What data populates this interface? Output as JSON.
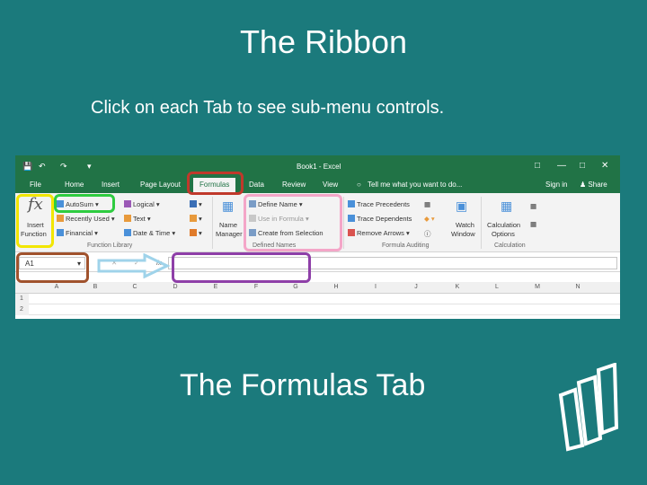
{
  "slide": {
    "title": "The Ribbon",
    "subtitle": "Click on each Tab to see sub-menu controls.",
    "caption": "The Formulas Tab"
  },
  "excel": {
    "window_title": "Book1 - Excel",
    "tabs": [
      "File",
      "Home",
      "Insert",
      "Page Layout",
      "Formulas",
      "Data",
      "Review",
      "View"
    ],
    "active_tab": "Formulas",
    "tell_me": "Tell me what you want to do...",
    "sign_in": "Sign in",
    "share": "Share",
    "function_library": {
      "insert_function": [
        "Insert",
        "Function"
      ],
      "autosum": "AutoSum",
      "recently_used": "Recently Used",
      "financial": "Financial",
      "logical": "Logical",
      "text": "Text",
      "date_time": "Date & Time",
      "group_label": "Function Library"
    },
    "defined_names": {
      "name_manager": [
        "Name",
        "Manager"
      ],
      "define_name": "Define Name",
      "use_in_formula": "Use in Formula",
      "create_from_selection": "Create from Selection",
      "group_label": "Defined Names"
    },
    "formula_auditing": {
      "trace_precedents": "Trace Precedents",
      "trace_dependents": "Trace Dependents",
      "remove_arrows": "Remove Arrows",
      "watch_window": [
        "Watch",
        "Window"
      ],
      "group_label": "Formula Auditing"
    },
    "calculation": {
      "calc_options": [
        "Calculation",
        "Options"
      ],
      "group_label": "Calculation"
    },
    "name_box_value": "A1",
    "fx_label": "fx",
    "columns": [
      "A",
      "B",
      "C",
      "D",
      "E",
      "F",
      "G",
      "H",
      "I",
      "J",
      "K",
      "L",
      "M",
      "N"
    ],
    "rows": [
      "1",
      "2"
    ]
  },
  "colors": {
    "background": "#1b7a7c",
    "excel_green": "#217346",
    "highlight_red": "#c0392b",
    "highlight_yellow": "#f2e600",
    "highlight_green": "#2ecc40",
    "highlight_pink": "#f4a6c8",
    "highlight_brown": "#a0522d",
    "highlight_purple": "#8e3fa8",
    "arrow_blue": "#9fd3ea"
  }
}
